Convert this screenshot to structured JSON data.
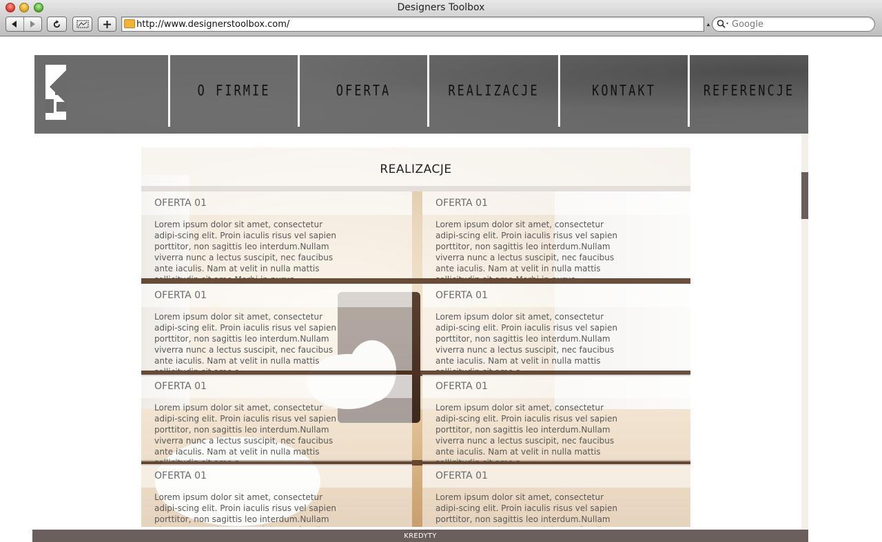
{
  "window": {
    "title": "Designers Toolbox"
  },
  "toolbar": {
    "back_icon": "back-arrow-icon",
    "forward_icon": "forward-arrow-icon",
    "reload_icon": "reload-icon",
    "snip_icon": "web-clip-icon",
    "add_icon": "plus-icon"
  },
  "address_bar": {
    "url": "http://www.designerstoolbox.com/"
  },
  "search": {
    "placeholder": "Google"
  },
  "nav": {
    "items": [
      {
        "label": "O FIRMIE"
      },
      {
        "label": "OFERTA"
      },
      {
        "label": "REALIZACJE"
      },
      {
        "label": "KONTAKT"
      },
      {
        "label": "REFERENCJE"
      }
    ]
  },
  "content": {
    "title": "REALIZACJE",
    "cards": [
      {
        "title": "OFERTA 01",
        "text": "Lorem ipsum dolor sit amet, consectetur adipi-scing elit. Proin iaculis risus vel sapien porttitor, non sagittis leo interdum.Nullam viverra nunc a lectus suscipit, nec faucibus ante iaculis. Nam at velit in nulla mattis sollicitudin sit ame Morbi in purus ullamcorper, accumsan urna"
      },
      {
        "title": "OFERTA 01",
        "text": "Lorem ipsum dolor sit amet, consectetur adipi-scing elit. Proin iaculis risus vel sapien porttitor, non sagittis leo interdum.Nullam viverra nunc a lectus suscipit, nec faucibus ante iaculis. Nam at velit in nulla mattis sollicitudin sit ame Morbi in purus ullamcorper, accumsan urna"
      },
      {
        "title": "OFERTA 01",
        "text": "Lorem ipsum dolor sit amet, consectetur adipi-scing elit. Proin iaculis risus vel sapien porttitor, non sagittis leo interdum.Nullam viverra nunc a lectus suscipit, nec faucibus ante iaculis. Nam at velit in nulla mattis sollicitudin sit ame a"
      },
      {
        "title": "OFERTA 01",
        "text": "Lorem ipsum dolor sit amet, consectetur adipi-scing elit. Proin iaculis risus vel sapien porttitor, non sagittis leo interdum.Nullam viverra nunc a lectus suscipit, nec faucibus ante iaculis. Nam at velit in nulla mattis sollicitudin sit ame a"
      },
      {
        "title": "OFERTA 01",
        "text": "Lorem ipsum dolor sit amet, consectetur adipi-scing elit. Proin iaculis risus vel sapien porttitor, non sagittis leo interdum.Nullam viverra nunc a lectus suscipit, nec faucibus ante iaculis. Nam at velit in nulla mattis sollicitudin sit ame a"
      },
      {
        "title": "OFERTA 01",
        "text": "Lorem ipsum dolor sit amet, consectetur adipi-scing elit. Proin iaculis risus vel sapien porttitor, non sagittis leo interdum.Nullam viverra nunc a lectus suscipit, nec faucibus ante iaculis. Nam at velit in nulla mattis sollicitudin sit ame a"
      },
      {
        "title": "OFERTA 01",
        "text": "Lorem ipsum dolor sit amet, consectetur adipi-scing elit. Proin iaculis risus vel sapien porttitor, non sagittis leo interdum.Nullam viverra nunc a lectus suscipit, nec faucibus ante iaculis."
      },
      {
        "title": "OFERTA 01",
        "text": "Lorem ipsum dolor sit amet, consectetur adipi-scing elit. Proin iaculis risus vel sapien porttitor, non sagittis leo interdum.Nullam viverra nunc a lectus suscipit, nec faucibus ante iaculis."
      }
    ]
  },
  "footer": {
    "label": "KREDYTY"
  },
  "colors": {
    "header_gray": "#6b6b6b",
    "footer_bg": "#6b5f5c",
    "scroll_thumb": "#6b5e5b"
  }
}
